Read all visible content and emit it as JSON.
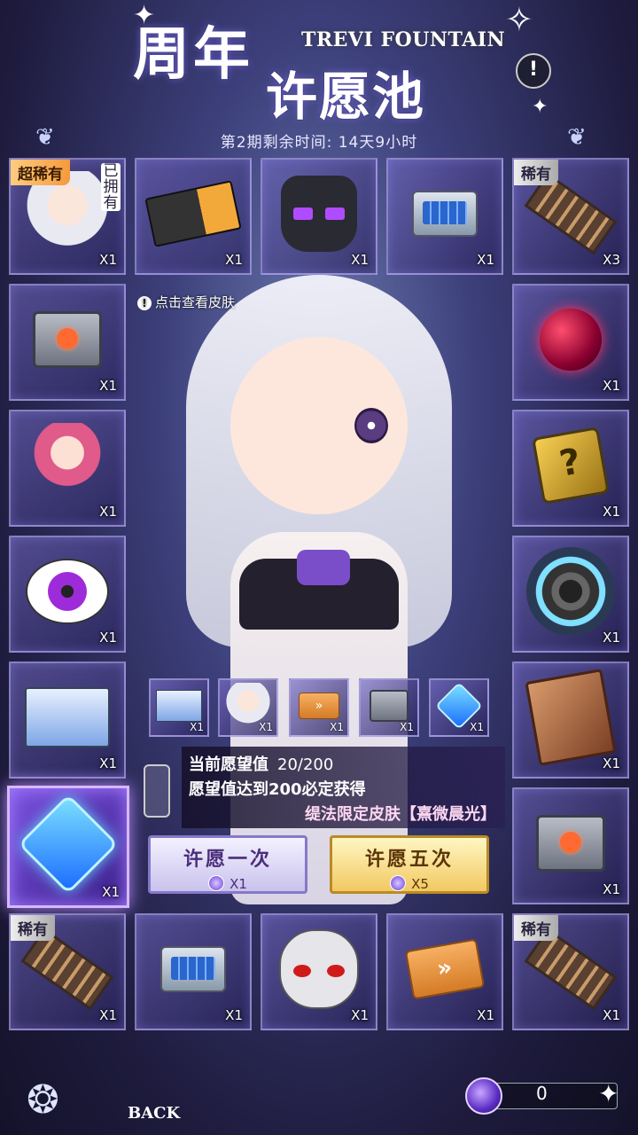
{
  "header": {
    "title_main": "周年",
    "title_sub": "许愿池",
    "title_en": "TREVI FOUNTAIN",
    "remaining_time": "第2期剩余时间: 14天9小时",
    "info_symbol": "!"
  },
  "skin_hint": "点击查看皮肤",
  "left_column": [
    {
      "rarity": "超稀有",
      "owned": "已拥有",
      "qty": "X1",
      "icon": "character-portrait-icon"
    },
    {
      "qty": "X1",
      "icon": "supply-crate-icon"
    },
    {
      "qty": "X1",
      "icon": "pink-hair-character-icon"
    },
    {
      "qty": "X1",
      "icon": "purple-eye-book-icon"
    },
    {
      "qty": "X1",
      "icon": "fix-body-box-icon"
    },
    {
      "qty": "X1",
      "icon": "blue-cube-icon",
      "selected": true
    }
  ],
  "top_row": [
    {
      "qty": "X1",
      "icon": "ticket-card-icon"
    },
    {
      "qty": "X1",
      "icon": "cat-mask-icon"
    },
    {
      "qty": "X1",
      "icon": "toolcase-icon"
    }
  ],
  "right_column": [
    {
      "rarity": "稀有",
      "qty": "X3",
      "icon": "film-reel-icon"
    },
    {
      "qty": "X1",
      "icon": "red-sphere-icon"
    },
    {
      "qty": "X1",
      "icon": "gold-chip-icon"
    },
    {
      "qty": "X1",
      "icon": "portal-lens-icon"
    },
    {
      "qty": "X1",
      "icon": "rust-book-icon"
    },
    {
      "qty": "X1",
      "icon": "supply-crate-icon"
    }
  ],
  "bottom_row": [
    {
      "rarity": "稀有",
      "qty": "X1",
      "icon": "film-reel-icon"
    },
    {
      "qty": "X1",
      "icon": "toolcase-icon"
    },
    {
      "qty": "X1",
      "icon": "white-mask-icon"
    },
    {
      "qty": "X1",
      "icon": "orange-chip-icon"
    },
    {
      "rarity": "稀有",
      "qty": "X1",
      "icon": "film-reel-icon"
    }
  ],
  "mini_rewards": [
    {
      "qty": "X1",
      "icon": "fix-body-box-icon"
    },
    {
      "qty": "X1",
      "icon": "character-portrait-icon"
    },
    {
      "qty": "X1",
      "icon": "orange-chip-icon"
    },
    {
      "qty": "X1",
      "icon": "supply-crate-icon"
    },
    {
      "qty": "X1",
      "icon": "blue-cube-icon"
    }
  ],
  "wish": {
    "value_label": "当前愿望值",
    "value": "20/200",
    "guarantee": "愿望值达到200必定获得",
    "skin_name": "缇法限定皮肤【熹微晨光】"
  },
  "buttons": {
    "wish_once": {
      "label": "许愿一次",
      "cost": "X1"
    },
    "wish_five": {
      "label": "许愿五次",
      "cost": "X5"
    }
  },
  "footer": {
    "back_label": "BACK",
    "currency_value": "0"
  },
  "colors": {
    "super_rare": "#f59a3c",
    "rare": "#cccccc",
    "selected_glow": "#b38cff"
  }
}
